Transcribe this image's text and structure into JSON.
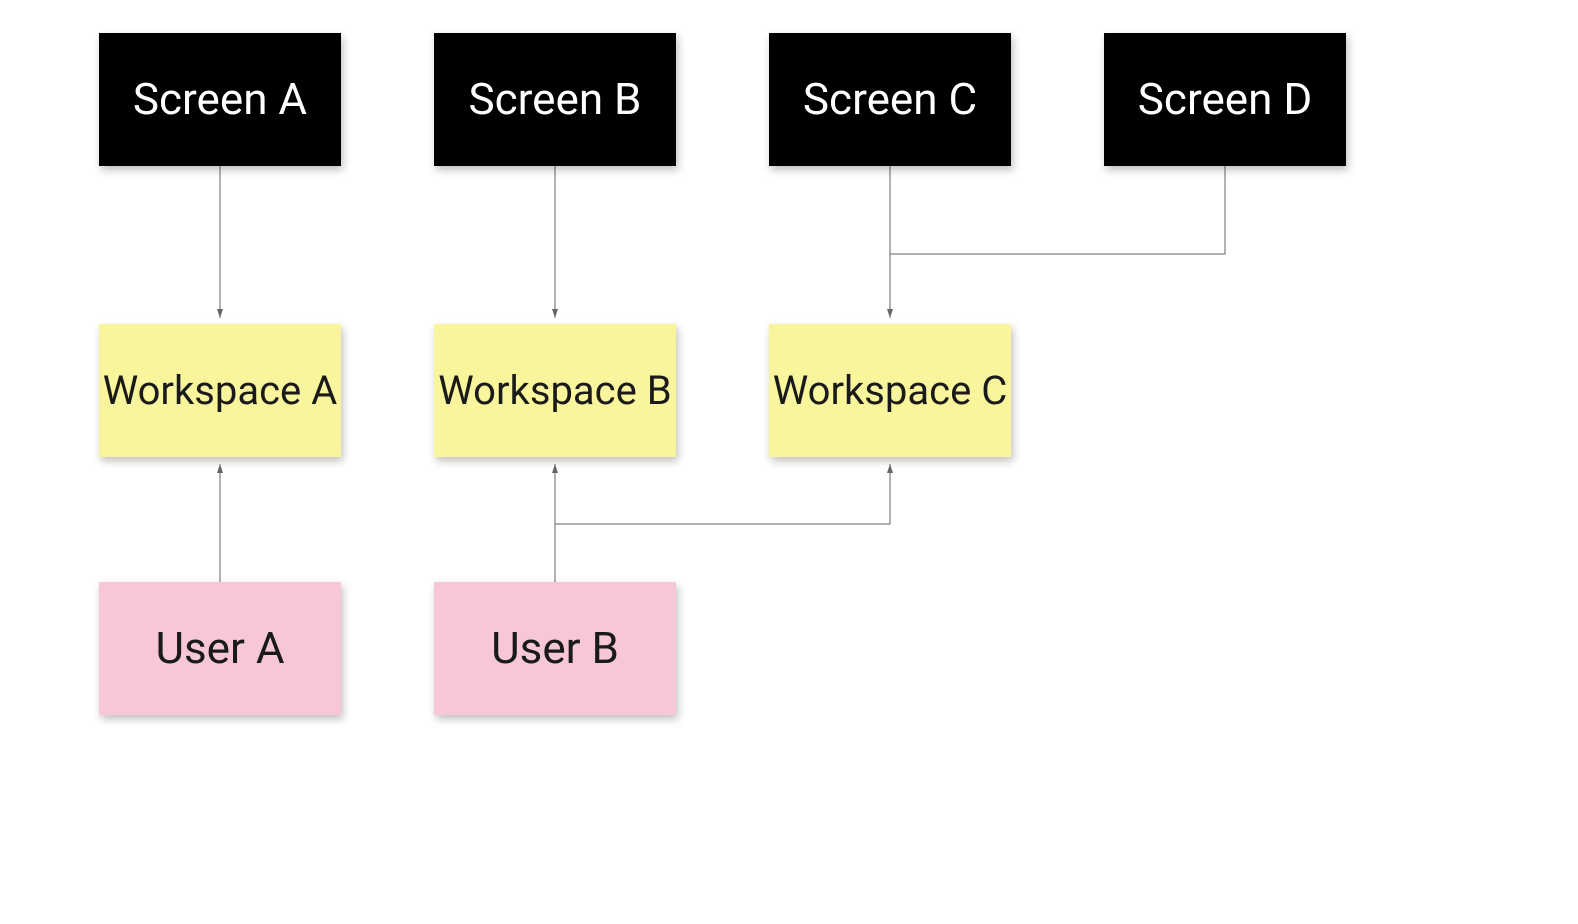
{
  "nodes": {
    "screen_a": {
      "label": "Screen A",
      "type": "screen"
    },
    "screen_b": {
      "label": "Screen B",
      "type": "screen"
    },
    "screen_c": {
      "label": "Screen C",
      "type": "screen"
    },
    "screen_d": {
      "label": "Screen D",
      "type": "screen"
    },
    "workspace_a": {
      "label": "Workspace A",
      "type": "workspace"
    },
    "workspace_b": {
      "label": "Workspace B",
      "type": "workspace"
    },
    "workspace_c": {
      "label": "Workspace C",
      "type": "workspace"
    },
    "user_a": {
      "label": "User A",
      "type": "user"
    },
    "user_b": {
      "label": "User B",
      "type": "user"
    }
  },
  "edges": [
    {
      "from": "screen_a",
      "to": "workspace_a"
    },
    {
      "from": "screen_b",
      "to": "workspace_b"
    },
    {
      "from": "screen_c",
      "to": "workspace_c"
    },
    {
      "from": "screen_d",
      "to": "workspace_c"
    },
    {
      "from": "user_a",
      "to": "workspace_a"
    },
    {
      "from": "user_b",
      "to": "workspace_b"
    },
    {
      "from": "user_b",
      "to": "workspace_c"
    }
  ],
  "colors": {
    "screen_bg": "#000000",
    "screen_fg": "#ffffff",
    "workspace_bg": "#f9f59c",
    "workspace_fg": "#1a1a1a",
    "user_bg": "#f7c7d9",
    "user_fg": "#1a1a1a",
    "connector": "#666666"
  }
}
